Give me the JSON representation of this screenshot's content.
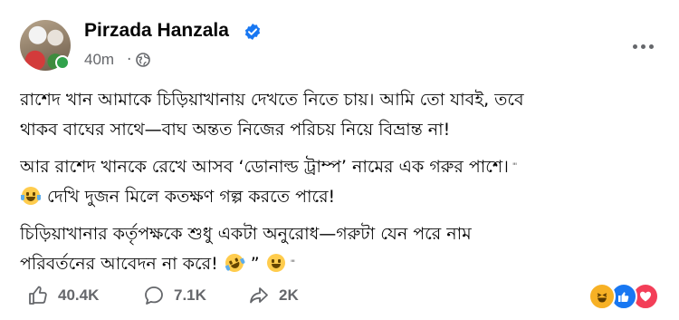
{
  "post": {
    "author": {
      "name": "Pirzada Hanzala",
      "verified": true,
      "online": true
    },
    "meta": {
      "time": "40m",
      "separator": "·",
      "audience_icon": "globe-icon"
    },
    "body": {
      "paragraphs": [
        {
          "lines": [
            "রাশেদ খান আমাকে চিড়িয়াখানায় দেখতে নিতে চায়। আমি তো যাবই, তবে",
            "থাকব বাঘের সাথে—বাঘ অন্তত নিজের পরিচয় নিয়ে বিভ্রান্ত না!"
          ]
        },
        {
          "lines": [
            "আর রাশেদ খানকে রেখে আসব ‘ডোনাল্ড ট্রাম্প’ নামের এক গরুর পাশে।",
            "দেখি দুজন মিলে কতক্ষণ গল্প করতে পারে!"
          ]
        },
        {
          "lines": [
            "চিড়িয়াখানার কর্তৃপক্ষকে শুধু একটা অনুরোধ—গরুটা যেন পরে নাম",
            "পরিবর্তনের আবেদন না করে!",
            "”"
          ]
        }
      ]
    },
    "stats": {
      "likes": "40.4K",
      "comments": "7.1K",
      "shares": "2K"
    },
    "reactions": [
      "haha",
      "like",
      "love"
    ],
    "colors": {
      "verified": "#1877f2",
      "online": "#31a24c",
      "muted_text": "#65676b"
    }
  }
}
